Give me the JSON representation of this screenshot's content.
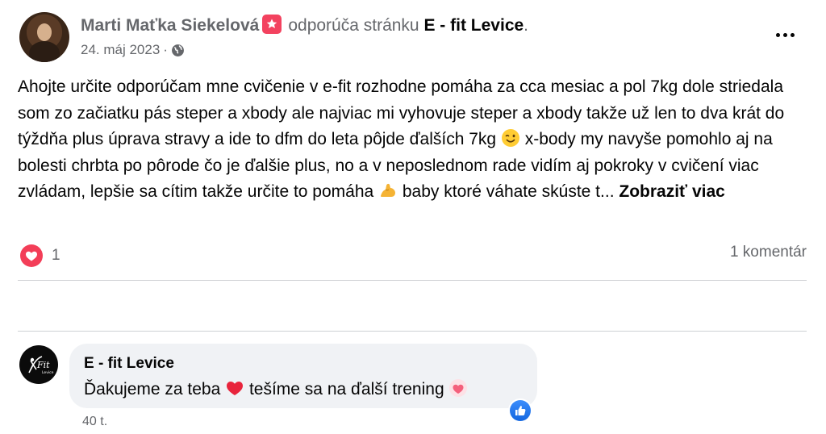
{
  "post": {
    "author": "Marti Maťka Siekelová",
    "action": "odporúča stránku",
    "page": "E - fit Levice",
    "punctuation": ".",
    "date": "24. máj 2023",
    "separator": "·",
    "text_part1": "Ahojte  určite odporúčam mne cvičenie v e-fit rozhodne pomáha za cca mesiac a pol 7kg dole striedala som zo začiatku pás steper a xbody ale najviac mi vyhovuje steper a xbody takže už len to dva krát do týždňa plus úprava stravy a ide to dfm do leta pôjde ďalších 7kg",
    "text_part2": "  x-body my navyše pomohlo aj na bolesti chrbta po pôrode čo je ďalšie plus, no a v neposlednom rade vidím aj pokroky v cvičení viac zvládam,  lepšie sa cítim takže určite to pomáha",
    "text_part3": " baby ktoré váhate skúste t...",
    "see_more": "Zobraziť viac"
  },
  "stats": {
    "reaction_count": "1",
    "comments_label": "1 komentár"
  },
  "comment": {
    "author": "E - fit Levice",
    "text_part1": "Ďakujeme za teba",
    "text_part2": " tešíme sa na ďalší trening",
    "time": "40 t."
  },
  "colors": {
    "love": "#f33e58",
    "like": "#1877f2",
    "badge": "#f3425f",
    "secondary_text": "#65676b",
    "bubble": "#f0f2f5"
  },
  "icons": [
    "recommend-icon",
    "globe-icon",
    "more-options-icon",
    "wink-emoji",
    "flexed-biceps-emoji",
    "love-reaction-icon",
    "red-heart-emoji",
    "sparkling-heart-emoji",
    "like-reaction-icon"
  ]
}
